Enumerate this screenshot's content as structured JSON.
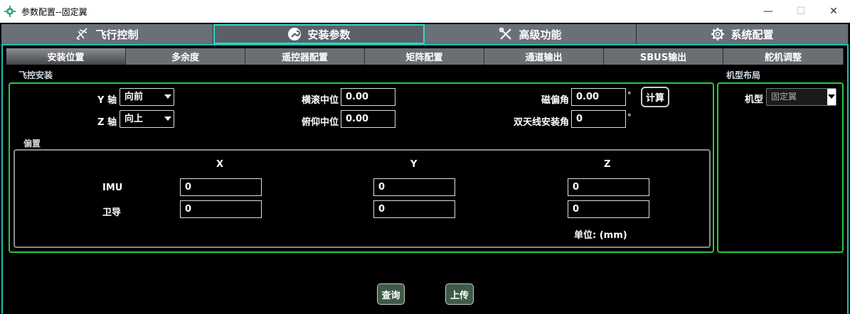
{
  "window": {
    "title": "参数配置--固定翼",
    "minimize_glyph": "—",
    "maximize_glyph": "☐",
    "close_glyph": "✕"
  },
  "main_tabs": [
    {
      "label": "飞行控制",
      "icon": "airplane-icon"
    },
    {
      "label": "安装参数",
      "icon": "wrench-icon",
      "active": true
    },
    {
      "label": "高级功能",
      "icon": "tools-icon"
    },
    {
      "label": "系统配置",
      "icon": "gear-icon"
    }
  ],
  "sub_tabs": [
    {
      "label": "安装位置",
      "active": true
    },
    {
      "label": "多余度"
    },
    {
      "label": "遥控器配置"
    },
    {
      "label": "矩阵配置"
    },
    {
      "label": "通道输出"
    },
    {
      "label": "SBUS输出"
    },
    {
      "label": "舵机调整"
    }
  ],
  "fc_install": {
    "section_label": "飞控安装",
    "y_axis_label": "Y 轴",
    "y_axis_value": "向前",
    "z_axis_label": "Z 轴",
    "z_axis_value": "向上",
    "roll_center_label": "横滚中位",
    "roll_center_value": "0.00",
    "pitch_center_label": "俯仰中位",
    "pitch_center_value": "0.00",
    "mag_dec_label": "磁偏角",
    "mag_dec_value": "0.00",
    "mag_dec_unit": "°",
    "calc_button": "计算",
    "dual_antenna_label": "双天线安装角",
    "dual_antenna_value": "0",
    "dual_antenna_unit": "°"
  },
  "offset": {
    "section_label": "偏置",
    "col_x": "X",
    "col_y": "Y",
    "col_z": "Z",
    "imu_label": "IMU",
    "imu": {
      "x": "0",
      "y": "0",
      "z": "0"
    },
    "gnss_label": "卫导",
    "gnss": {
      "x": "0",
      "y": "0",
      "z": "0"
    },
    "unit_label": "单位: (mm)"
  },
  "airframe": {
    "section_label": "机型布局",
    "type_label": "机型",
    "type_value": "固定翼"
  },
  "actions": {
    "query": "查询",
    "upload": "上传"
  },
  "colors": {
    "active_tab_border": "#25e0c8",
    "frame_border": "#1fbdb0",
    "group_border": "#27c93f",
    "action_button": "#3f5a48"
  }
}
